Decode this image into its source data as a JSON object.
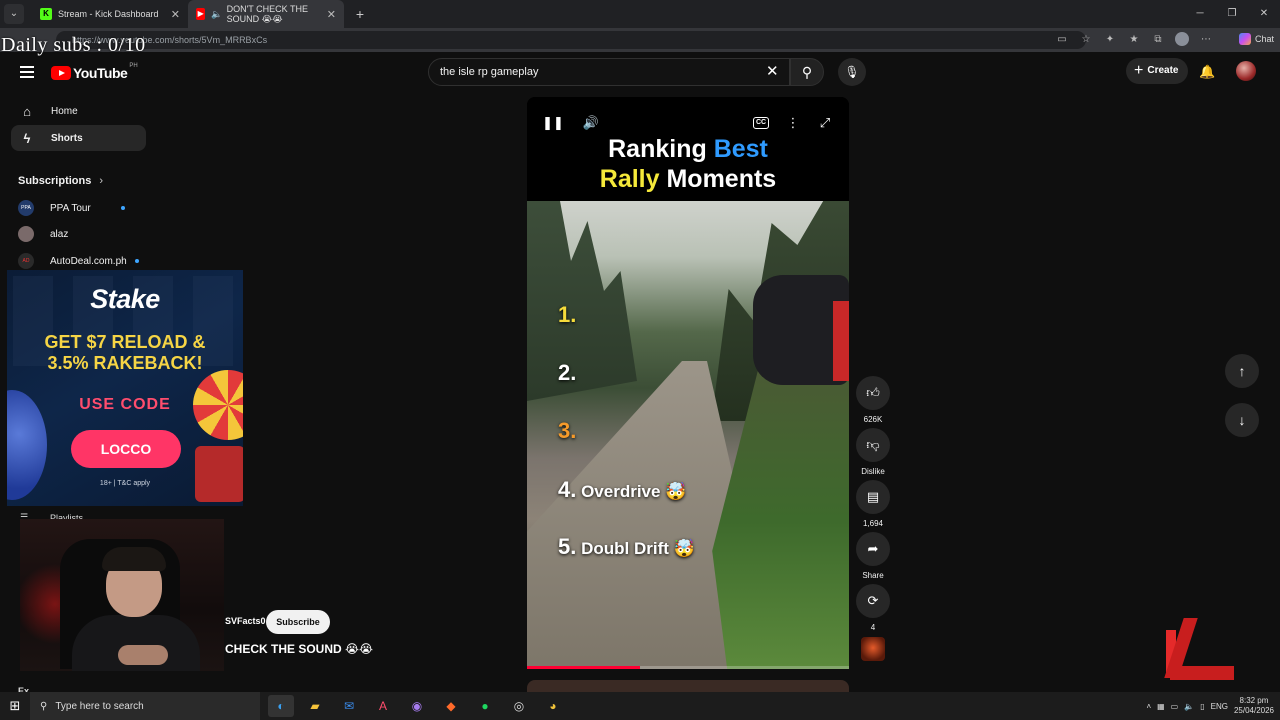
{
  "browser": {
    "tabs": [
      {
        "label": "Stream - Kick Dashboard",
        "favicon": "kick-icon",
        "active": false
      },
      {
        "label": "DON'T CHECK THE SOUND 😭😭",
        "favicon": "youtube-icon",
        "active": true
      }
    ],
    "url": "https://www.youtube.com/shorts/5Vm_MRRBxCs",
    "chat_label": "Chat"
  },
  "overlay": {
    "daily_subs": "Daily subs : 0/10"
  },
  "youtube": {
    "logo_text": "YouTube",
    "logo_country": "PH",
    "search_value": "the isle rp gameplay",
    "create_label": "Create"
  },
  "sidebar": {
    "items": [
      {
        "label": "Home",
        "icon": "home-icon",
        "active": false
      },
      {
        "label": "Shorts",
        "icon": "shorts-icon",
        "active": true
      }
    ],
    "subscriptions_heading": "Subscriptions",
    "subscriptions": [
      {
        "name": "PPA Tour",
        "avatar_text": "PPA",
        "new": true
      },
      {
        "name": "alaz",
        "avatar_text": "",
        "new": false
      },
      {
        "name": "AutoDeal.com.ph",
        "avatar_text": "AD",
        "new": true
      }
    ],
    "playlists_label": "Playlists",
    "explore_label": "Ex"
  },
  "ad": {
    "brand": "Stake",
    "line1": "GET $7 RELOAD &",
    "line2": "3.5% RAKEBACK!",
    "use_code": "USE CODE",
    "code": "LOCCO",
    "legal": "18+ | T&C apply"
  },
  "short": {
    "title_line1_a": "Ranking ",
    "title_line1_b": "Best",
    "title_line2_a": "Rally",
    "title_line2_b": " Moments",
    "ranks": [
      {
        "num": "1.",
        "text": ""
      },
      {
        "num": "2.",
        "text": ""
      },
      {
        "num": "3.",
        "text": ""
      },
      {
        "num": "4.",
        "text": " Overdrive 🤯"
      },
      {
        "num": "5.",
        "text": " Doubl Drift 🤯"
      }
    ],
    "cc_label": "CC",
    "progress": 0.35,
    "channel": "SVFacts0",
    "subscribe_label": "Subscribe",
    "caption": "CHECK THE SOUND 😭😭"
  },
  "actions": {
    "likes": "626K",
    "dislike_label": "Dislike",
    "comments": "1,694",
    "share_label": "Share",
    "remix_count": "4"
  },
  "taskbar": {
    "search_placeholder": "Type here to search",
    "lang": "ENG",
    "time": "8:32 pm",
    "date": "25/04/2026"
  }
}
